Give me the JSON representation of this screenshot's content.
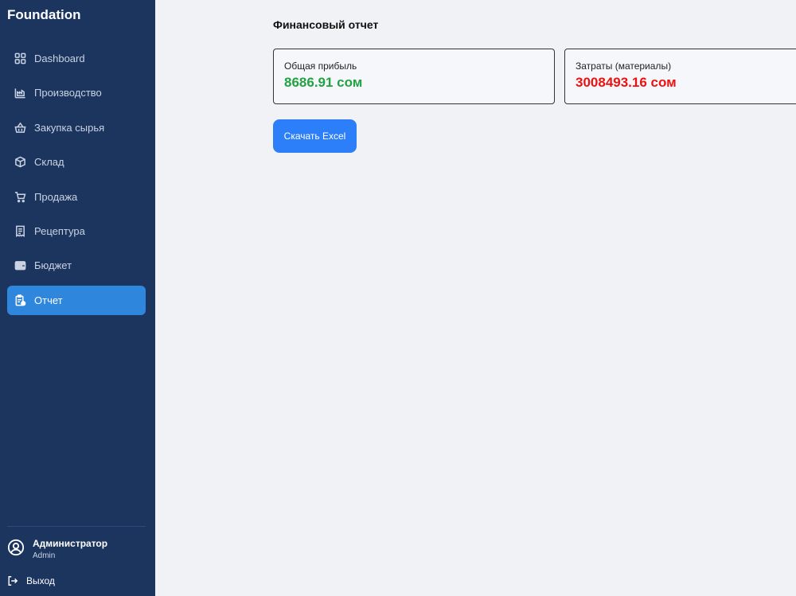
{
  "app": {
    "brand": "Foundation"
  },
  "sidebar": {
    "items": [
      {
        "label": "Dashboard",
        "icon": "dashboard-grid-icon",
        "active": false
      },
      {
        "label": "Производство",
        "icon": "factory-icon",
        "active": false
      },
      {
        "label": "Закупка сырья",
        "icon": "basket-icon",
        "active": false
      },
      {
        "label": "Склад",
        "icon": "box-icon",
        "active": false
      },
      {
        "label": "Продажа",
        "icon": "cart-icon",
        "active": false
      },
      {
        "label": "Рецептура",
        "icon": "receipt-icon",
        "active": false
      },
      {
        "label": "Бюджет",
        "icon": "wallet-icon",
        "active": false
      },
      {
        "label": "Отчет",
        "icon": "report-clipboard-icon",
        "active": true
      }
    ]
  },
  "user": {
    "name": "Администратор",
    "role": "Admin",
    "logout_label": "Выход"
  },
  "main": {
    "title": "Финансовый отчет",
    "cards": [
      {
        "label": "Общая прибыль",
        "value": "8686.91 сом",
        "color": "#22a244"
      },
      {
        "label": "Затраты (материалы)",
        "value": "3008493.16 сом",
        "color": "#ee1111"
      }
    ],
    "export_button": "Скачать Excel"
  },
  "colors": {
    "sidebar_bg": "#1c355e",
    "accent": "#2f86dd",
    "button": "#2d7ff9",
    "page_bg": "#f0f2f6"
  }
}
